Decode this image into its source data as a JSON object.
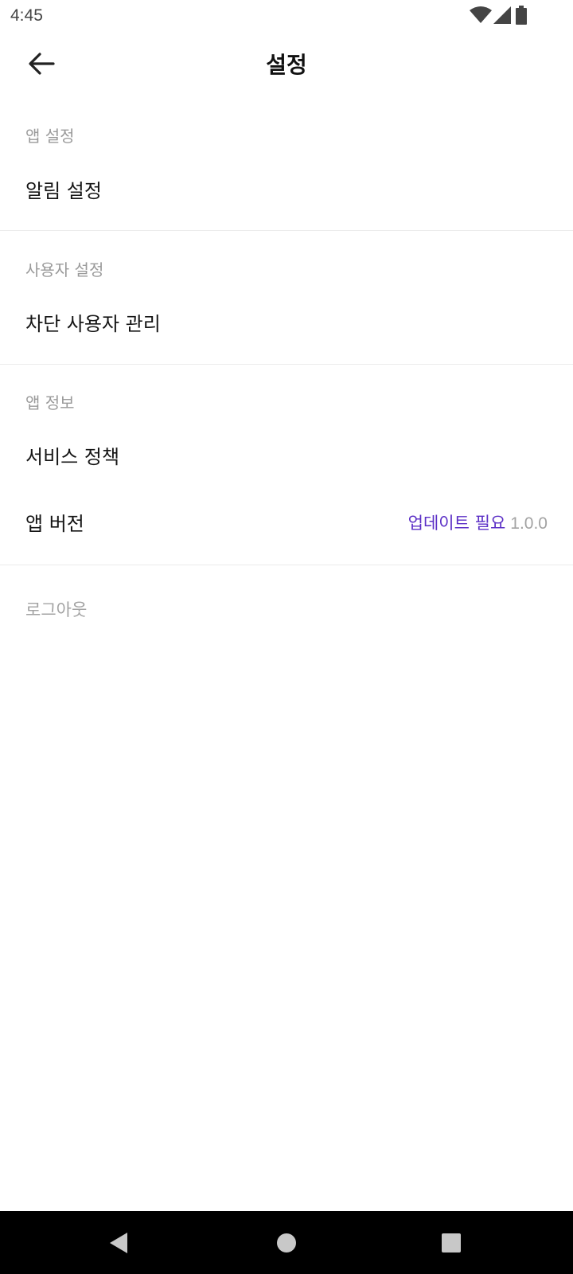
{
  "status_bar": {
    "time": "4:45",
    "icons": [
      "wifi-icon",
      "signal-icon",
      "battery-icon"
    ]
  },
  "app_bar": {
    "back_icon": "arrow-left-icon",
    "title": "설정"
  },
  "sections": [
    {
      "header": "앱 설정",
      "items": [
        {
          "label": "알림 설정"
        }
      ]
    },
    {
      "header": "사용자 설정",
      "items": [
        {
          "label": "차단 사용자 관리"
        }
      ]
    },
    {
      "header": "앱 정보",
      "items": [
        {
          "label": "서비스 정책"
        },
        {
          "label": "앱 버전",
          "status": "업데이트 필요",
          "version": "1.0.0"
        }
      ]
    }
  ],
  "logout_label": "로그아웃",
  "colors": {
    "accent": "#5b2fc6",
    "muted_text": "#9a9a9a",
    "divider": "#ececec"
  },
  "nav_bar": {
    "icons": [
      "back-triangle-icon",
      "home-circle-icon",
      "recents-square-icon"
    ]
  }
}
